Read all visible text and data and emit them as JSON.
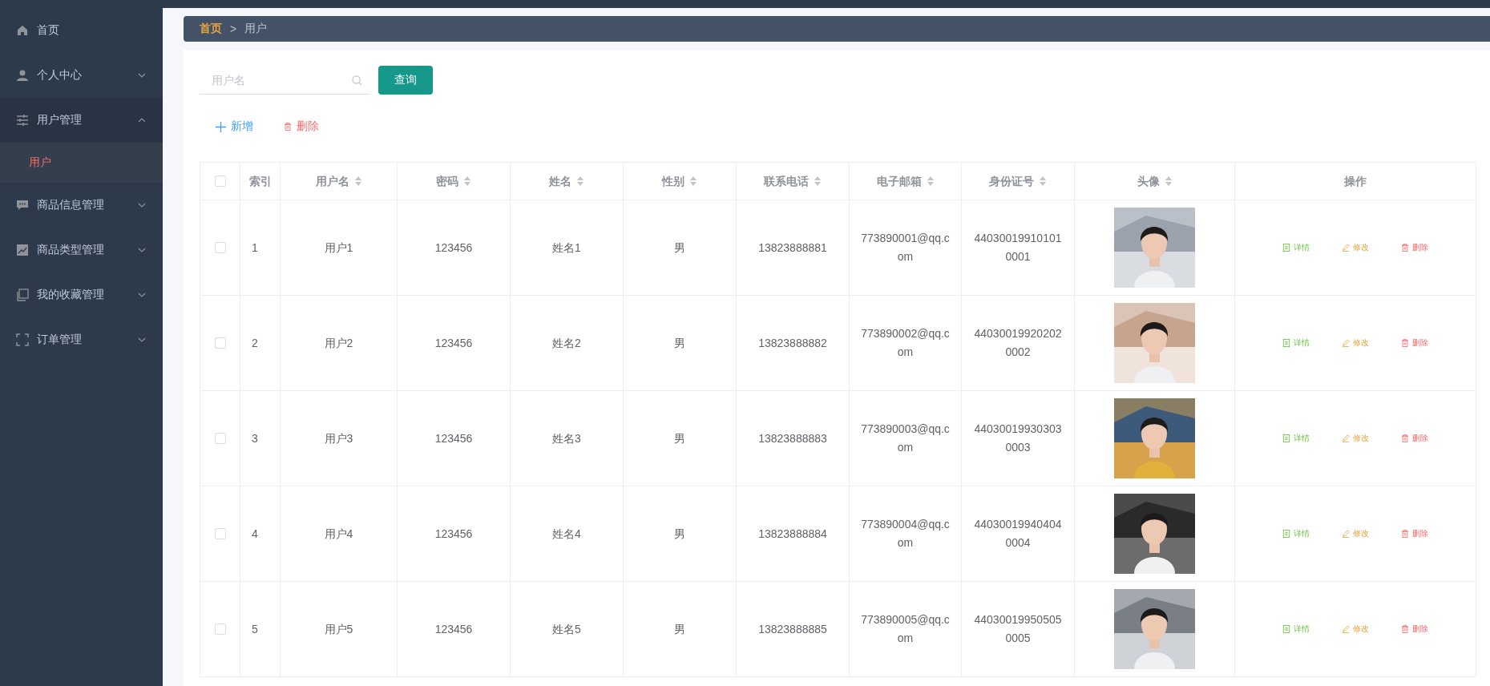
{
  "sidebar": {
    "items": [
      {
        "kind": "link",
        "label": "首页"
      },
      {
        "kind": "menu",
        "label": "个人中心",
        "expanded": false
      },
      {
        "kind": "menu",
        "label": "用户管理",
        "expanded": true,
        "children": [
          {
            "label": "用户",
            "selected": true
          }
        ]
      },
      {
        "kind": "menu",
        "label": "商品信息管理",
        "expanded": false
      },
      {
        "kind": "menu",
        "label": "商品类型管理",
        "expanded": false
      },
      {
        "kind": "menu",
        "label": "我的收藏管理",
        "expanded": false
      },
      {
        "kind": "menu",
        "label": "订单管理",
        "expanded": false
      }
    ]
  },
  "breadcrumb": {
    "items": [
      "首页",
      "用户"
    ],
    "separator": ">"
  },
  "search": {
    "placeholder": "用户名",
    "button": "查询"
  },
  "toolbar": [
    {
      "kind": "add",
      "label": "新增"
    },
    {
      "kind": "delete",
      "label": "删除"
    }
  ],
  "table": {
    "select_all": {
      "checked": false
    },
    "columns": [
      {
        "label": "索引",
        "sortable": false
      },
      {
        "label": "用户名",
        "sortable": true
      },
      {
        "label": "密码",
        "sortable": true
      },
      {
        "label": "姓名",
        "sortable": true
      },
      {
        "label": "性别",
        "sortable": true
      },
      {
        "label": "联系电话",
        "sortable": true
      },
      {
        "label": "电子邮箱",
        "sortable": true
      },
      {
        "label": "身份证号",
        "sortable": true
      },
      {
        "label": "头像",
        "sortable": true
      },
      {
        "label": "操作",
        "sortable": false
      }
    ],
    "rows": [
      {
        "checked": false,
        "cells": [
          "1",
          "用户1",
          "123456",
          "姓名1",
          "男",
          "13823888881",
          "773890001@qq.com",
          "440300199101010001"
        ],
        "actions": [
          {
            "kind": "detail",
            "label": "详情"
          },
          {
            "kind": "edit",
            "label": "修改"
          },
          {
            "kind": "delete",
            "label": "删除"
          }
        ]
      },
      {
        "checked": false,
        "cells": [
          "2",
          "用户2",
          "123456",
          "姓名2",
          "男",
          "13823888882",
          "773890002@qq.com",
          "440300199202020002"
        ],
        "actions": [
          {
            "kind": "detail",
            "label": "详情"
          },
          {
            "kind": "edit",
            "label": "修改"
          },
          {
            "kind": "delete",
            "label": "删除"
          }
        ]
      },
      {
        "checked": false,
        "cells": [
          "3",
          "用户3",
          "123456",
          "姓名3",
          "男",
          "13823888883",
          "773890003@qq.com",
          "440300199303030003"
        ],
        "actions": [
          {
            "kind": "detail",
            "label": "详情"
          },
          {
            "kind": "edit",
            "label": "修改"
          },
          {
            "kind": "delete",
            "label": "删除"
          }
        ]
      },
      {
        "checked": false,
        "cells": [
          "4",
          "用户4",
          "123456",
          "姓名4",
          "男",
          "13823888884",
          "773890004@qq.com",
          "440300199404040004"
        ],
        "actions": [
          {
            "kind": "detail",
            "label": "详情"
          },
          {
            "kind": "edit",
            "label": "修改"
          },
          {
            "kind": "delete",
            "label": "删除"
          }
        ]
      },
      {
        "checked": false,
        "cells": [
          "5",
          "用户5",
          "123456",
          "姓名5",
          "男",
          "13823888885",
          "773890005@qq.com",
          "440300199505050005"
        ],
        "actions": [
          {
            "kind": "detail",
            "label": "详情"
          },
          {
            "kind": "edit",
            "label": "修改"
          },
          {
            "kind": "delete",
            "label": "删除"
          }
        ]
      }
    ]
  }
}
